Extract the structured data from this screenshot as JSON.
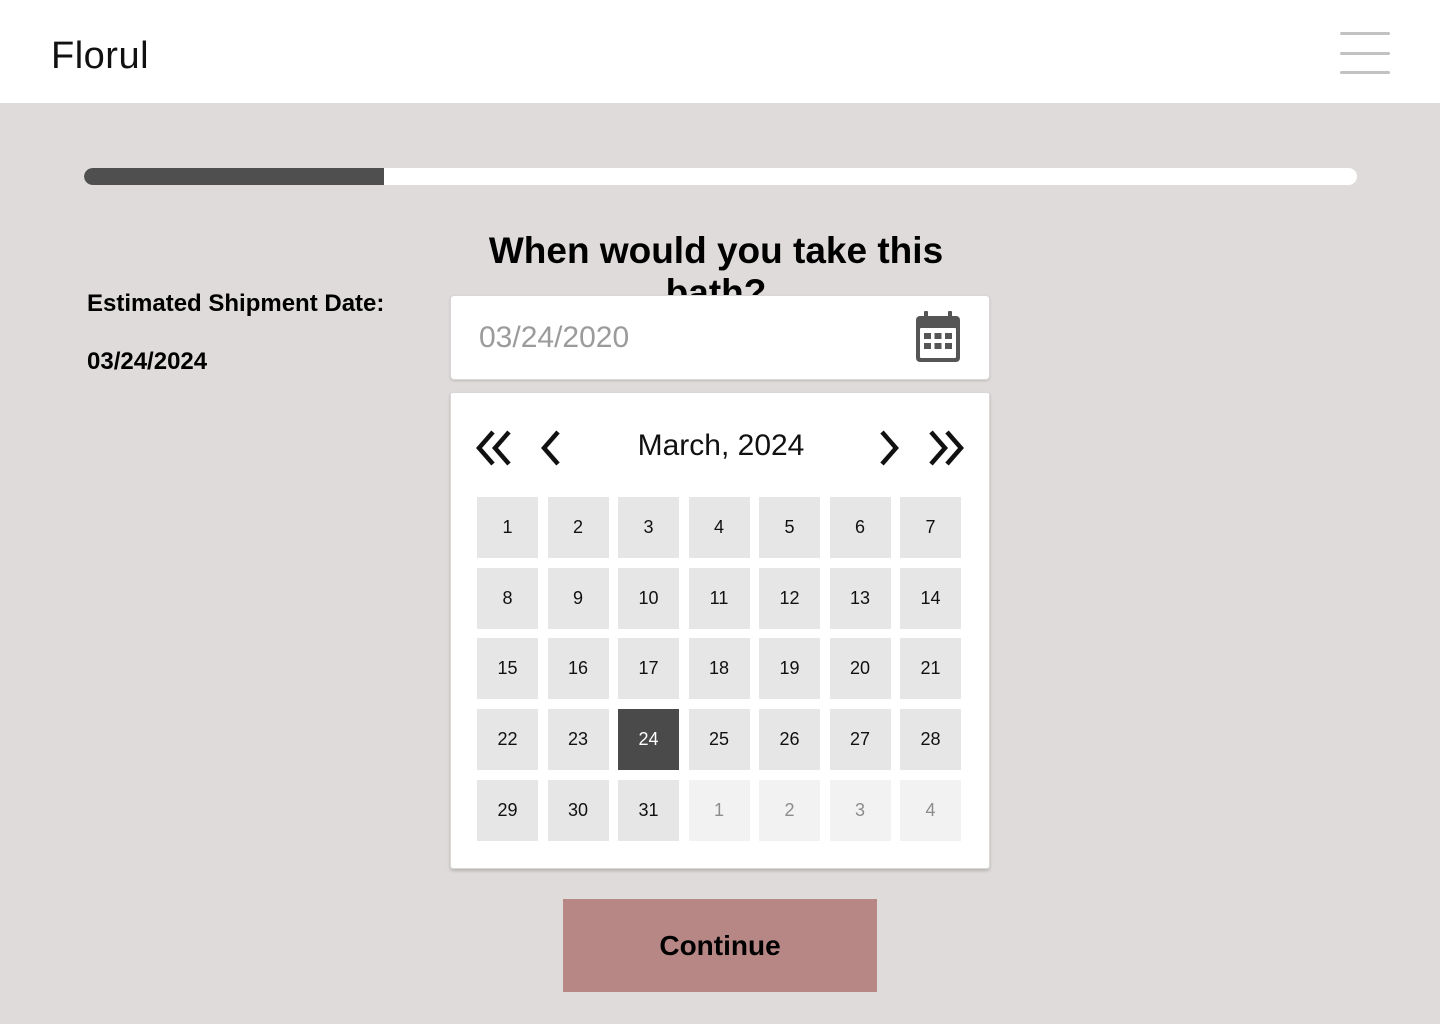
{
  "header": {
    "brand": "Florul"
  },
  "progress": {
    "fraction": 0.236
  },
  "question": "When would you take this bath?",
  "shipment": {
    "label": "Estimated Shipment Date:",
    "value": "03/24/2024"
  },
  "date_field": {
    "placeholder": "03/24/2020"
  },
  "calendar": {
    "month_label": "March, 2024",
    "days": [
      {
        "label": "1"
      },
      {
        "label": "2"
      },
      {
        "label": "3"
      },
      {
        "label": "4"
      },
      {
        "label": "5"
      },
      {
        "label": "6"
      },
      {
        "label": "7"
      },
      {
        "label": "8"
      },
      {
        "label": "9"
      },
      {
        "label": "10"
      },
      {
        "label": "11"
      },
      {
        "label": "12"
      },
      {
        "label": "13"
      },
      {
        "label": "14"
      },
      {
        "label": "15"
      },
      {
        "label": "16"
      },
      {
        "label": "17"
      },
      {
        "label": "18"
      },
      {
        "label": "19"
      },
      {
        "label": "20"
      },
      {
        "label": "21"
      },
      {
        "label": "22"
      },
      {
        "label": "23"
      },
      {
        "label": "24",
        "selected": true
      },
      {
        "label": "25"
      },
      {
        "label": "26"
      },
      {
        "label": "27"
      },
      {
        "label": "28"
      },
      {
        "label": "29"
      },
      {
        "label": "30"
      },
      {
        "label": "31"
      },
      {
        "label": "1",
        "muted": true
      },
      {
        "label": "2",
        "muted": true
      },
      {
        "label": "3",
        "muted": true
      },
      {
        "label": "4",
        "muted": true
      }
    ]
  },
  "continue_label": "Continue",
  "icons": {
    "menu": "hamburger-menu-icon",
    "calendar": "calendar-icon",
    "prev_year": "double-chevron-left-icon",
    "prev_month": "chevron-left-icon",
    "next_month": "chevron-right-icon",
    "next_year": "double-chevron-right-icon"
  },
  "colors": {
    "background": "#dfdbda",
    "progress_fill": "#4f4f4f",
    "selected_day": "#4a4a4a",
    "continue_button": "#b78786"
  }
}
